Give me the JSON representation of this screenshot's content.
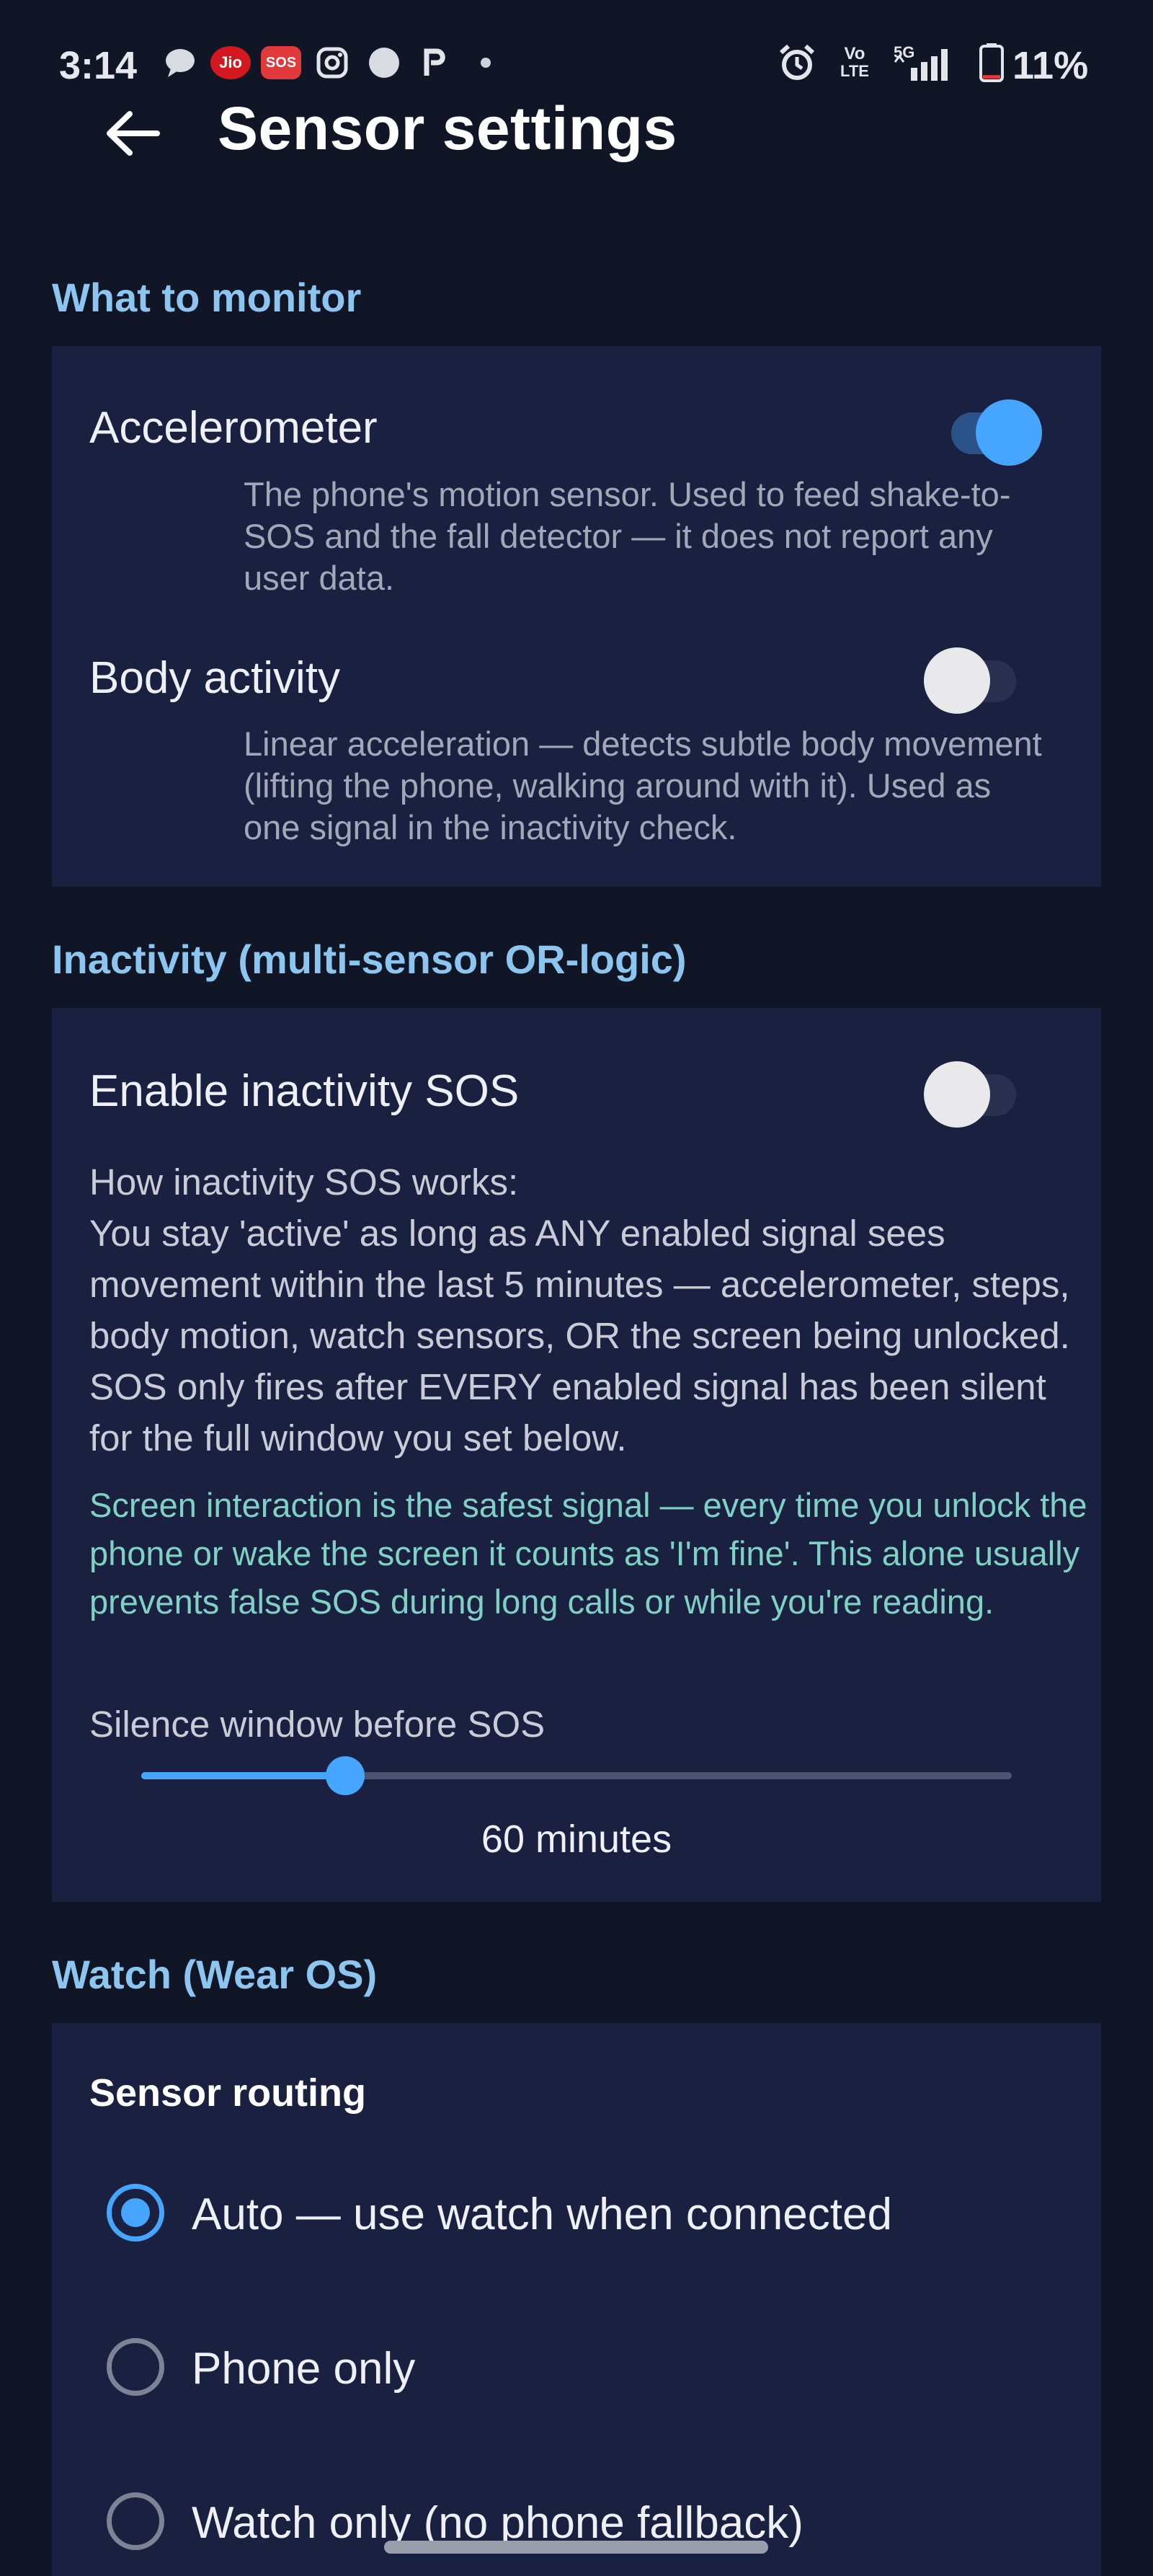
{
  "status_bar": {
    "time": "3:14",
    "notification_icons": [
      "chat-bubble-icon",
      "jio-icon",
      "sos-icon",
      "instagram-icon",
      "circle-app-icon",
      "paytm-icon",
      "dot-icon"
    ],
    "jio_label": "Jio",
    "sos_label": "SOS",
    "volte_label_top": "Vo",
    "volte_label_bottom": "LTE",
    "network_label": "5G",
    "battery_percent": "11%",
    "battery_level": 0.11
  },
  "header": {
    "title": "Sensor settings"
  },
  "monitor": {
    "header": "What to monitor",
    "accelerometer": {
      "label": "Accelerometer",
      "enabled": true,
      "description": "The phone's motion sensor. Used to feed shake-to-SOS and the fall detector — it does not report any user data."
    },
    "body_activity": {
      "label": "Body activity",
      "enabled": false,
      "description": "Linear acceleration — detects subtle body movement (lifting the phone, walking around with it). Used as one signal in the inactivity check."
    }
  },
  "inactivity": {
    "header": "Inactivity (multi-sensor OR-logic)",
    "toggle_label": "Enable inactivity SOS",
    "enabled": false,
    "how_title": "How inactivity SOS works:",
    "how_body": "You stay 'active' as long as ANY enabled signal sees movement within the last 5 minutes — accelerometer, steps, body motion, watch sensors, OR the screen being unlocked. SOS only fires after EVERY enabled signal has been silent for the full window you set below.",
    "tip": "Screen interaction is the safest signal — every time you unlock the phone or wake the screen it counts as 'I'm fine'. This alone usually prevents false SOS during long calls or while you're reading.",
    "slider_label": "Silence window before SOS",
    "slider_fraction": 0.234,
    "slider_value_text": "60 minutes"
  },
  "watch": {
    "header": "Watch (Wear OS)",
    "routing_title": "Sensor routing",
    "options": [
      {
        "label": "Auto — use watch when connected",
        "selected": true
      },
      {
        "label": "Phone only",
        "selected": false
      },
      {
        "label": "Watch only (no phone fallback)",
        "selected": false
      }
    ]
  },
  "colors": {
    "background": "#111627",
    "card": "#1a2140",
    "accent": "#45a5ff",
    "section_header": "#8cc6f0",
    "tip_text": "#7fd1c4"
  }
}
